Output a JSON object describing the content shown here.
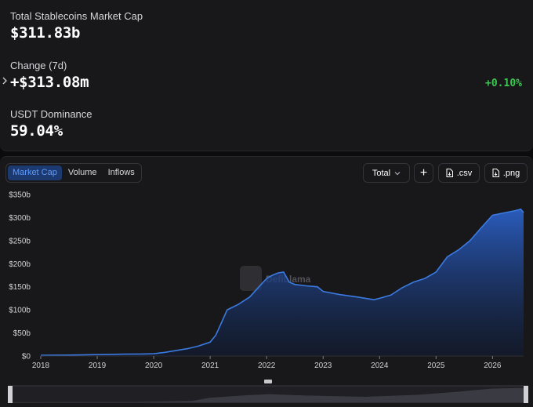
{
  "stats": {
    "total_label": "Total Stablecoins Market Cap",
    "total_value": "$311.83b",
    "change_label": "Change (7d)",
    "change_value": "+$313.08m",
    "change_pct": "+0.10%",
    "dominance_label": "USDT Dominance",
    "dominance_value": "59.04%"
  },
  "toolbar": {
    "tabs": [
      {
        "label": "Market Cap",
        "active": true
      },
      {
        "label": "Volume",
        "active": false
      },
      {
        "label": "Inflows",
        "active": false
      }
    ],
    "total_select": "Total",
    "add_label": "+",
    "csv_label": ".csv",
    "png_label": ".png"
  },
  "watermark": "DefiLlama",
  "colors": {
    "accent": "#3b7ae0",
    "positive": "#3fc552",
    "background": "#18181b"
  },
  "chart_data": {
    "type": "area",
    "title": "",
    "xlabel": "",
    "ylabel": "",
    "xlim": [
      2018.0,
      2026.55
    ],
    "ylim": [
      0,
      350
    ],
    "yticks": [
      {
        "value": 0,
        "label": "$0"
      },
      {
        "value": 50,
        "label": "$50b"
      },
      {
        "value": 100,
        "label": "$100b"
      },
      {
        "value": 150,
        "label": "$150b"
      },
      {
        "value": 200,
        "label": "$200b"
      },
      {
        "value": 250,
        "label": "$250b"
      },
      {
        "value": 300,
        "label": "$300b"
      },
      {
        "value": 350,
        "label": "$350b"
      }
    ],
    "xticks": [
      {
        "value": 2018,
        "label": "2018"
      },
      {
        "value": 2019,
        "label": "2019"
      },
      {
        "value": 2020,
        "label": "2020"
      },
      {
        "value": 2021,
        "label": "2021"
      },
      {
        "value": 2022,
        "label": "2022"
      },
      {
        "value": 2023,
        "label": "2023"
      },
      {
        "value": 2024,
        "label": "2024"
      },
      {
        "value": 2025,
        "label": "2025"
      },
      {
        "value": 2026,
        "label": "2026"
      }
    ],
    "grid": false,
    "series": [
      {
        "x": [
          2018.0,
          2018.5,
          2019.0,
          2019.5,
          2019.8,
          2020.0,
          2020.2,
          2020.4,
          2020.6,
          2020.8,
          2021.0,
          2021.1,
          2021.2,
          2021.3,
          2021.4,
          2021.5,
          2021.7,
          2021.9,
          2022.0,
          2022.1,
          2022.2,
          2022.3,
          2022.4,
          2022.5,
          2022.7,
          2022.9,
          2023.0,
          2023.3,
          2023.6,
          2023.9,
          2024.0,
          2024.2,
          2024.4,
          2024.6,
          2024.8,
          2025.0,
          2025.2,
          2025.4,
          2025.6,
          2025.8,
          2026.0,
          2026.2,
          2026.4,
          2026.5,
          2026.55
        ],
        "values": [
          1.5,
          2,
          3,
          4,
          4.5,
          5,
          8,
          12,
          16,
          22,
          30,
          45,
          72,
          100,
          106,
          112,
          128,
          155,
          168,
          175,
          180,
          182,
          160,
          155,
          152,
          150,
          140,
          133,
          128,
          122,
          125,
          132,
          148,
          160,
          168,
          182,
          215,
          230,
          250,
          278,
          305,
          310,
          315,
          318,
          311
        ]
      }
    ]
  },
  "brush_data": {
    "x": [
      2018.0,
      2019.0,
      2020.0,
      2021.0,
      2021.3,
      2021.9,
      2022.3,
      2022.9,
      2023.9,
      2024.8,
      2025.4,
      2026.0,
      2026.5,
      2026.55
    ],
    "values": [
      1.5,
      3,
      5,
      30,
      100,
      155,
      182,
      150,
      122,
      168,
      230,
      305,
      318,
      311
    ]
  }
}
